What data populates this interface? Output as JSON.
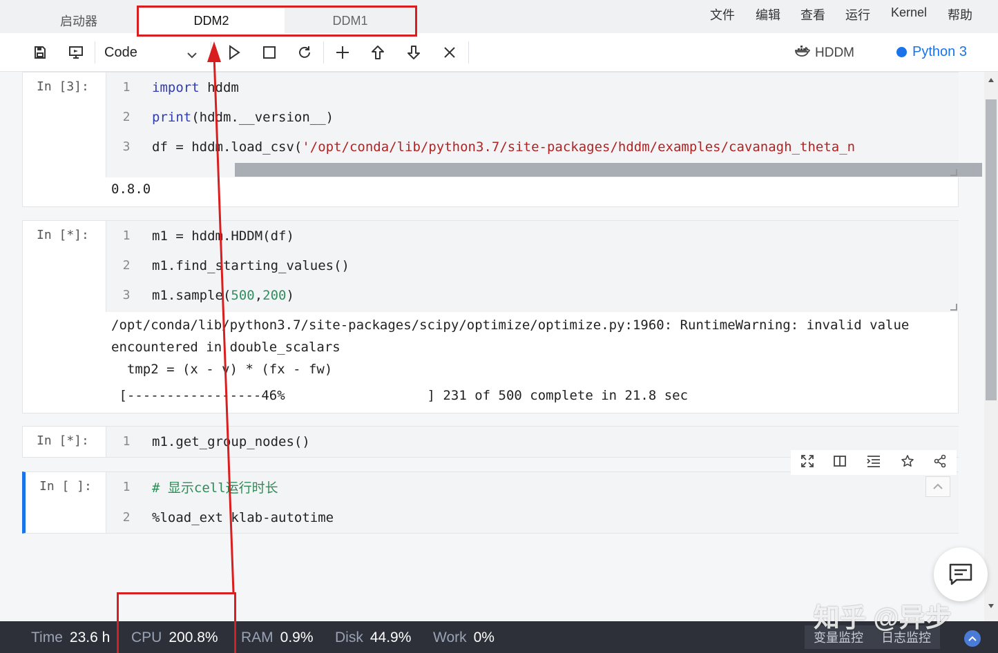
{
  "tabs": [
    {
      "label": "启动器",
      "active": false
    },
    {
      "label": "DDM2",
      "active": true
    },
    {
      "label": "DDM1",
      "active": false
    }
  ],
  "menu": [
    "文件",
    "编辑",
    "查看",
    "运行",
    "Kernel",
    "帮助"
  ],
  "toolbar": {
    "cell_type": "Code",
    "kernel_name": "HDDM",
    "kernel_status": "Python 3"
  },
  "cells": [
    {
      "prompt": "In [3]:",
      "lines": [
        {
          "num": "1",
          "tokens": [
            {
              "t": "import",
              "c": "kw"
            },
            {
              "t": " hddm",
              "c": ""
            }
          ]
        },
        {
          "num": "2",
          "tokens": [
            {
              "t": "print",
              "c": "kw"
            },
            {
              "t": "(hddm.__version__)",
              "c": ""
            }
          ]
        },
        {
          "num": "3",
          "tokens": [
            {
              "t": "df = hddm.load_csv(",
              "c": ""
            },
            {
              "t": "'/opt/conda/lib/python3.7/site-packages/hddm/examples/cavanagh_theta_n",
              "c": "str"
            }
          ]
        }
      ],
      "output": [
        "0.8.0"
      ]
    },
    {
      "prompt": "In [*]:",
      "lines": [
        {
          "num": "1",
          "tokens": [
            {
              "t": "m1 = hddm.HDDM(df)",
              "c": ""
            }
          ]
        },
        {
          "num": "2",
          "tokens": [
            {
              "t": "m1.find_starting_values()",
              "c": ""
            }
          ]
        },
        {
          "num": "3",
          "tokens": [
            {
              "t": "m1.sample(",
              "c": ""
            },
            {
              "t": "500",
              "c": "num"
            },
            {
              "t": ",",
              "c": ""
            },
            {
              "t": "200",
              "c": "num"
            },
            {
              "t": ")",
              "c": ""
            }
          ]
        }
      ],
      "output": [
        "/opt/conda/lib/python3.7/site-packages/scipy/optimize/optimize.py:1960: RuntimeWarning: invalid value",
        "encountered in double_scalars",
        "  tmp2 = (x - v) * (fx - fw)",
        " [-----------------46%                  ] 231 of 500 complete in 21.8 sec"
      ]
    },
    {
      "prompt": "In [*]:",
      "lines": [
        {
          "num": "1",
          "tokens": [
            {
              "t": "m1.get_group_nodes()",
              "c": ""
            }
          ]
        }
      ],
      "output": []
    },
    {
      "prompt": "In [ ]:",
      "lines": [
        {
          "num": "1",
          "tokens": [
            {
              "t": "# 显示cell运行时长",
              "c": "cm"
            }
          ]
        },
        {
          "num": "2",
          "tokens": [
            {
              "t": "%load_ext klab-autotime",
              "c": ""
            }
          ]
        }
      ],
      "output": []
    }
  ],
  "status": {
    "time": {
      "label": "Time",
      "value": "23.6 h"
    },
    "cpu": {
      "label": "CPU",
      "value": "200.8%"
    },
    "ram": {
      "label": "RAM",
      "value": "0.9%"
    },
    "disk": {
      "label": "Disk",
      "value": "44.9%"
    },
    "work": {
      "label": "Work",
      "value": "0%"
    },
    "monitors": [
      "变量监控",
      "日志监控"
    ]
  },
  "watermark": "知乎 @异步",
  "colors": {
    "accent": "#1a73e8",
    "annotation": "#d81e1e",
    "statusbar": "#2d3038"
  }
}
